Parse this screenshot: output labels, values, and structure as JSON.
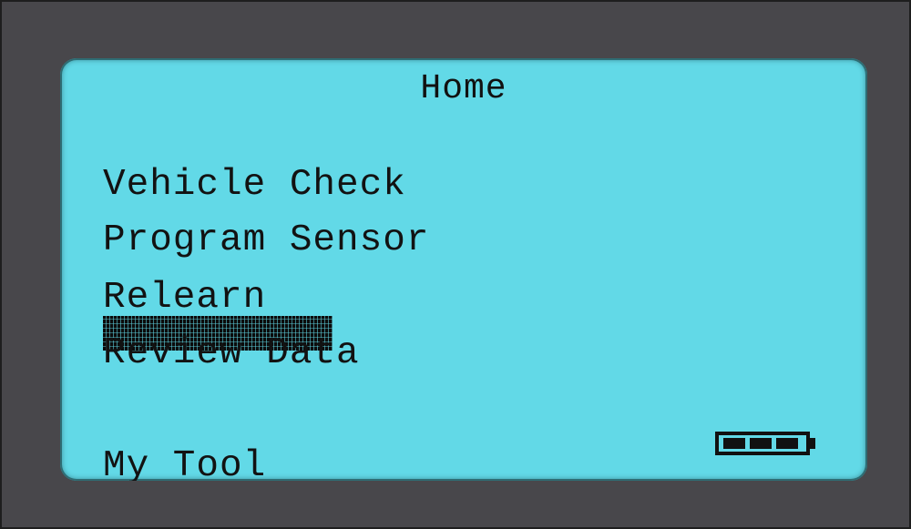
{
  "screen": {
    "title": "Home",
    "menu": [
      {
        "label": "Vehicle Check"
      },
      {
        "label": "Program Sensor"
      },
      {
        "label": "Relearn"
      },
      {
        "label": "Review Data"
      },
      {
        "label": "My Tool"
      }
    ],
    "selected_index": 3,
    "battery_icon": "battery-full-icon"
  },
  "colors": {
    "bezel": "#48474b",
    "screen": "#62d9e7",
    "text": "#121212"
  }
}
